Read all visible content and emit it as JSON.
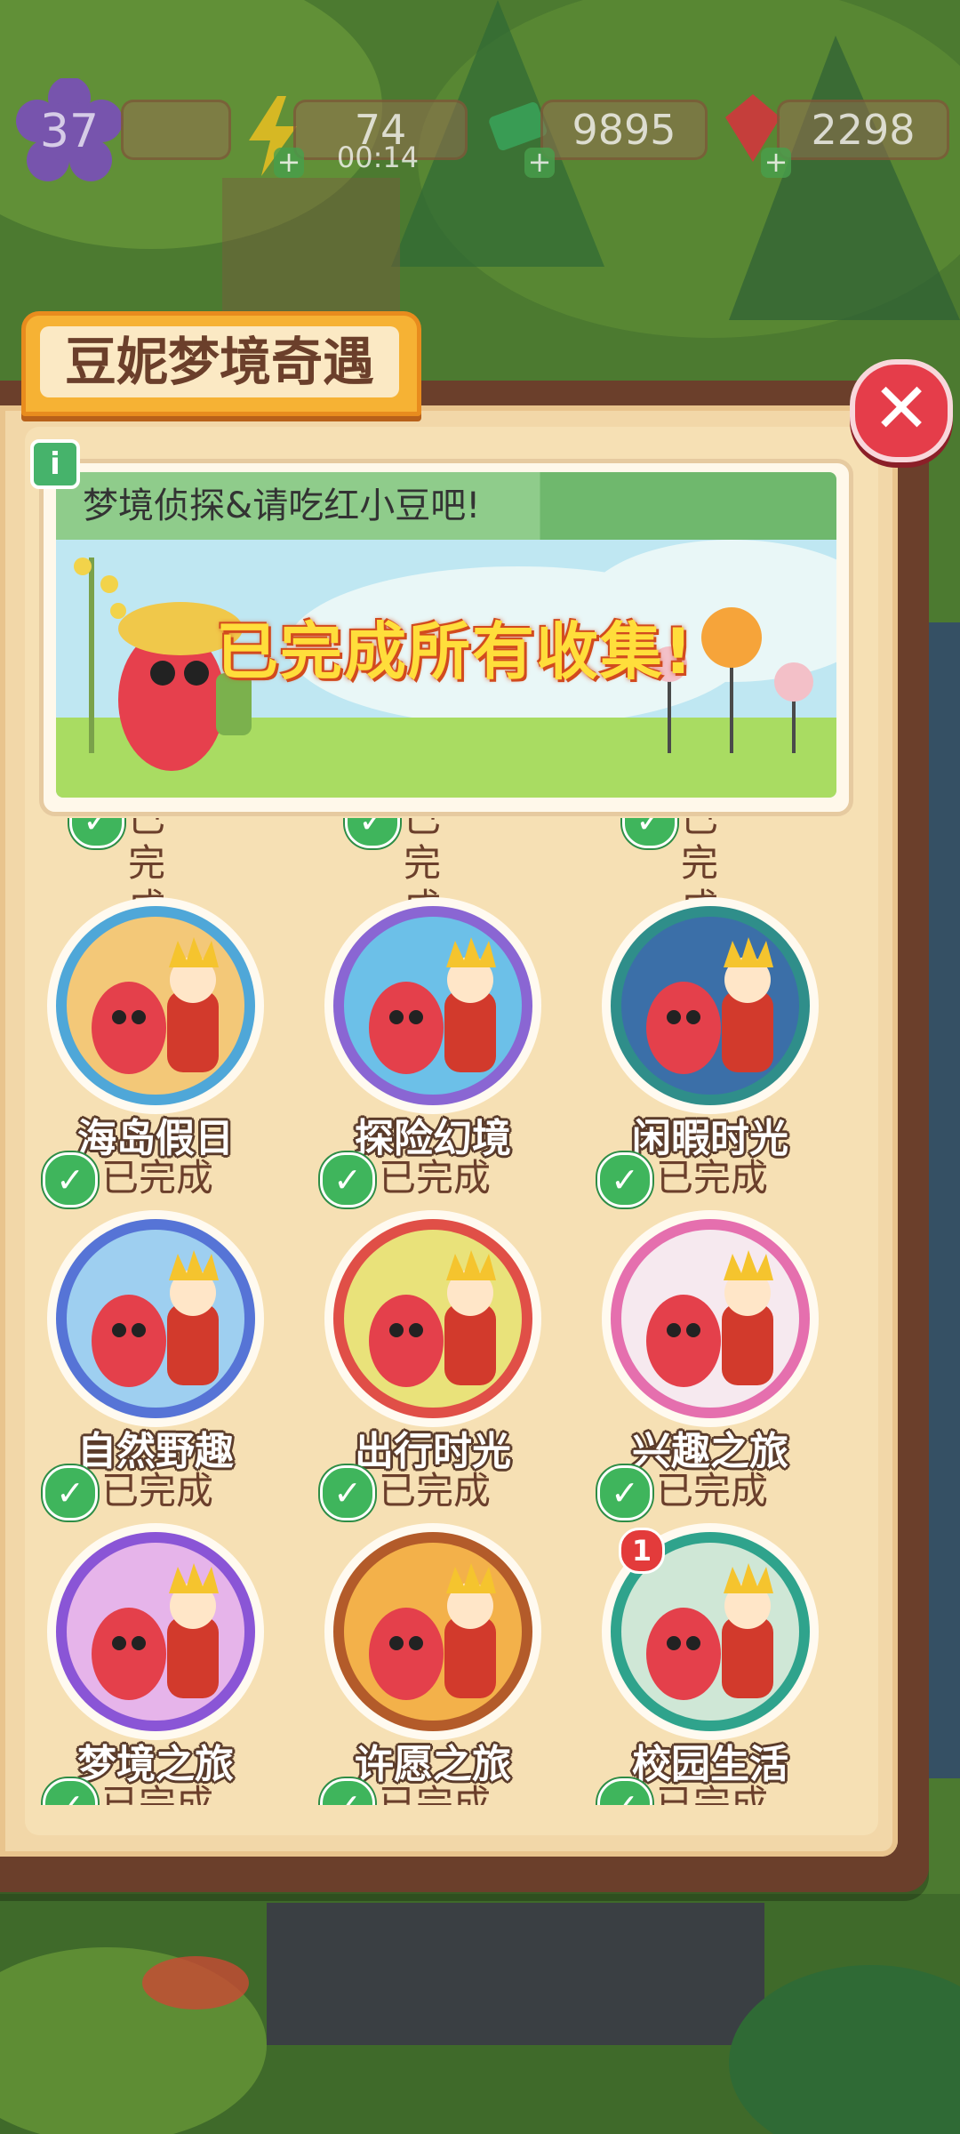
{
  "hud": {
    "level": "37",
    "energy": "74",
    "energy_timer": "00:14",
    "cash": "9895",
    "gems": "2298"
  },
  "panel": {
    "title": "豆妮梦境奇遇",
    "close": "✕",
    "info": "i",
    "banner_heading": "梦境侦探&请吃红小豆吧!",
    "banner_status": "已完成所有收集!"
  },
  "items": [
    {
      "name": "海岛假日",
      "status": "已完成",
      "ring": "#4fa7d8",
      "bg": "#f3c878"
    },
    {
      "name": "探险幻境",
      "status": "已完成",
      "ring": "#8a66d3",
      "bg": "#6cc0e8"
    },
    {
      "name": "闲暇时光",
      "status": "已完成",
      "ring": "#2f8e8a",
      "bg": "#3b6fa8"
    },
    {
      "name": "自然野趣",
      "status": "已完成",
      "ring": "#5674d6",
      "bg": "#9ecff0"
    },
    {
      "name": "出行时光",
      "status": "已完成",
      "ring": "#e04f47",
      "bg": "#e9e27a"
    },
    {
      "name": "兴趣之旅",
      "status": "已完成",
      "ring": "#e56fae",
      "bg": "#f6e9ef"
    },
    {
      "name": "梦境之旅",
      "status": "已完成",
      "ring": "#8a55d6",
      "bg": "#e6b4ea"
    },
    {
      "name": "许愿之旅",
      "status": "已完成",
      "ring": "#b35b2a",
      "bg": "#f3b14a"
    },
    {
      "name": "校园生活",
      "status": "已完成",
      "ring": "#2fa38c",
      "bg": "#cfe7d6",
      "badge": "1"
    }
  ],
  "partial_row_status": "已完成",
  "colors": {
    "accent": "#f6b234",
    "close": "#e53d4a",
    "check": "#3fb55c",
    "paper": "#f2d7a8",
    "frame": "#6b3f2b"
  }
}
